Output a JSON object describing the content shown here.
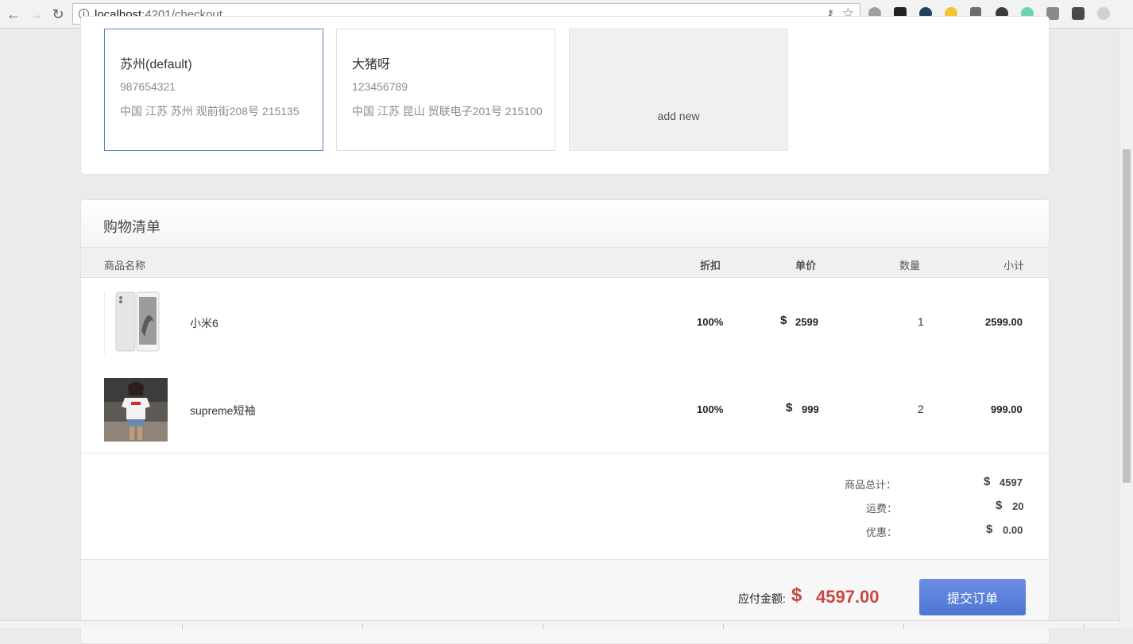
{
  "browser": {
    "url_host": "localhost",
    "url_path": ":4201/checkout"
  },
  "addresses": {
    "cards": [
      {
        "name": "苏州(default)",
        "phone": "987654321",
        "address": "中国 江苏 苏州 观前街208号 215135",
        "selected": true
      },
      {
        "name": "大猪呀",
        "phone": "123456789",
        "address": "中国 江苏 昆山 贸联电子201号 215100",
        "selected": false
      }
    ],
    "add_new_label": "add new"
  },
  "cart": {
    "title": "购物清单",
    "columns": {
      "name": "商品名称",
      "discount": "折扣",
      "unit_price": "单价",
      "quantity": "数量",
      "subtotal": "小计"
    },
    "items": [
      {
        "name": "小米6",
        "discount": "100%",
        "currency": "$",
        "price": "2599",
        "quantity": "1",
        "subtotal": "2599.00"
      },
      {
        "name": "supreme短袖",
        "discount": "100%",
        "currency": "$",
        "price": "999",
        "quantity": "2",
        "subtotal": "999.00"
      }
    ],
    "summary": {
      "goods_total_label": "商品总计：",
      "goods_total_currency": "$",
      "goods_total": "4597",
      "shipping_label": "运费：",
      "shipping_currency": "$",
      "shipping": "20",
      "discount_label": "优惠：",
      "discount_currency": "$",
      "discount": "0.00"
    },
    "due_label": "应付金额:",
    "due_currency": "$",
    "due_amount": "4597.00",
    "submit_label": "提交订单"
  },
  "colors": {
    "accent_blue": "#5c7fc7",
    "price_red": "#c84842"
  }
}
